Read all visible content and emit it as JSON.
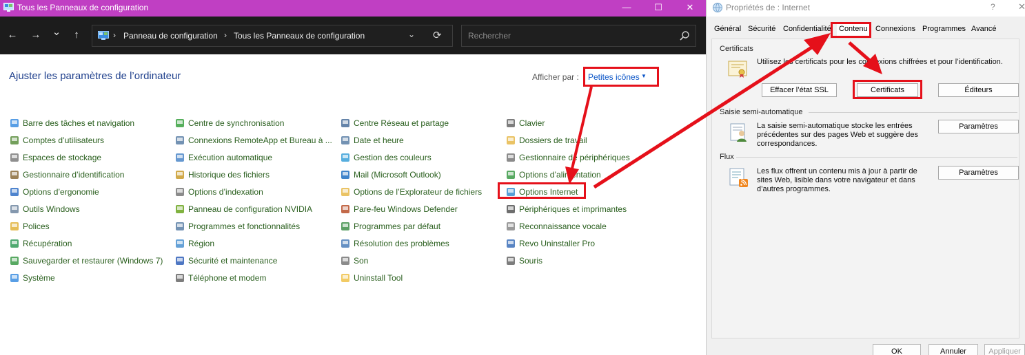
{
  "cp": {
    "title": "Tous les Panneaux de configuration",
    "window_min": "—",
    "window_max": "☐",
    "window_close": "✕",
    "nav_back": "←",
    "nav_forward": "→",
    "nav_recent": "⌄",
    "nav_up": "↑",
    "breadcrumb": [
      "Panneau de configuration",
      "Tous les Panneaux de configuration"
    ],
    "breadcrumb_sep": "›",
    "address_dropdown": "⌄",
    "refresh": "⟳",
    "search_placeholder": "Rechercher",
    "heading": "Ajuster les paramètres de l’ordinateur",
    "view_by_label": "Afficher par :",
    "view_by_value": "Petites icônes",
    "view_by_caret": "▼",
    "columns": [
      [
        {
          "label": "Barre des tâches et navigation",
          "icon": "taskbar-icon"
        },
        {
          "label": "Comptes d’utilisateurs",
          "icon": "users-icon"
        },
        {
          "label": "Espaces de stockage",
          "icon": "storage-icon"
        },
        {
          "label": "Gestionnaire d’identification",
          "icon": "credential-icon"
        },
        {
          "label": "Options d’ergonomie",
          "icon": "ergonomics-icon"
        },
        {
          "label": "Outils Windows",
          "icon": "tools-icon"
        },
        {
          "label": "Polices",
          "icon": "fonts-icon"
        },
        {
          "label": "Récupération",
          "icon": "recovery-icon"
        },
        {
          "label": "Sauvegarder et restaurer (Windows 7)",
          "icon": "backup-icon"
        },
        {
          "label": "Système",
          "icon": "system-icon"
        }
      ],
      [
        {
          "label": "Centre de synchronisation",
          "icon": "sync-icon"
        },
        {
          "label": "Connexions RemoteApp et Bureau à ...",
          "icon": "remoteapp-icon"
        },
        {
          "label": "Exécution automatique",
          "icon": "autoplay-icon"
        },
        {
          "label": "Historique des fichiers",
          "icon": "file-history-icon"
        },
        {
          "label": "Options d’indexation",
          "icon": "indexing-icon"
        },
        {
          "label": "Panneau de configuration NVIDIA",
          "icon": "nvidia-icon"
        },
        {
          "label": "Programmes et fonctionnalités",
          "icon": "programs-icon"
        },
        {
          "label": "Région",
          "icon": "region-icon"
        },
        {
          "label": "Sécurité et maintenance",
          "icon": "security-flag-icon"
        },
        {
          "label": "Téléphone et modem",
          "icon": "phone-icon"
        }
      ],
      [
        {
          "label": "Centre Réseau et partage",
          "icon": "network-icon"
        },
        {
          "label": "Date et heure",
          "icon": "clock-icon"
        },
        {
          "label": "Gestion des couleurs",
          "icon": "color-icon"
        },
        {
          "label": "Mail (Microsoft Outlook)",
          "icon": "mail-icon"
        },
        {
          "label": "Options de l’Explorateur de fichiers",
          "icon": "folder-options-icon"
        },
        {
          "label": "Pare-feu Windows Defender",
          "icon": "firewall-icon"
        },
        {
          "label": "Programmes par défaut",
          "icon": "default-programs-icon"
        },
        {
          "label": "Résolution des problèmes",
          "icon": "troubleshoot-icon"
        },
        {
          "label": "Son",
          "icon": "sound-icon"
        },
        {
          "label": "Uninstall Tool",
          "icon": "folder-icon"
        }
      ],
      [
        {
          "label": "Clavier",
          "icon": "keyboard-icon"
        },
        {
          "label": "Dossiers de travail",
          "icon": "work-folders-icon"
        },
        {
          "label": "Gestionnaire de périphériques",
          "icon": "device-manager-icon"
        },
        {
          "label": "Options d’alimentation",
          "icon": "power-icon"
        },
        {
          "label": "Options Internet",
          "icon": "internet-options-icon"
        },
        {
          "label": "Périphériques et imprimantes",
          "icon": "printer-icon"
        },
        {
          "label": "Reconnaissance vocale",
          "icon": "microphone-icon"
        },
        {
          "label": "Revo Uninstaller Pro",
          "icon": "revo-icon"
        },
        {
          "label": "Souris",
          "icon": "mouse-icon"
        }
      ]
    ]
  },
  "ip": {
    "title": "Propriétés de : Internet",
    "help": "?",
    "close": "✕",
    "tabs": [
      "Général",
      "Sécurité",
      "Confidentialité",
      "Contenu",
      "Connexions",
      "Programmes",
      "Avancé"
    ],
    "active_tab": "Contenu",
    "certificates": {
      "heading": "Certificats",
      "text": "Utilisez les certificats pour les connexions chiffrées et pour l’identification.",
      "clear_ssl": "Effacer l’état SSL",
      "certificates_btn": "Certificats",
      "publishers_btn": "Éditeurs"
    },
    "autocomplete": {
      "heading": "Saisie semi-automatique",
      "text": [
        "La saisie semi-automatique stocke les entrées",
        "précédentes sur des pages Web et suggère des",
        "correspondances."
      ],
      "settings_btn": "Paramètres"
    },
    "feeds": {
      "heading": "Flux",
      "text": [
        "Les flux offrent un contenu mis à jour à partir de",
        "sites Web, lisible dans votre navigateur et dans",
        "d’autres programmes."
      ],
      "settings_btn": "Paramètres"
    },
    "footer": {
      "ok": "OK",
      "cancel": "Annuler",
      "apply": "Appliquer"
    }
  },
  "colors": {
    "titlebar": "#c03fc3",
    "nav": "#1c1c1c",
    "link": "#2a5f1e",
    "heading": "#1e3f8c",
    "highlight": "#e5101a"
  }
}
